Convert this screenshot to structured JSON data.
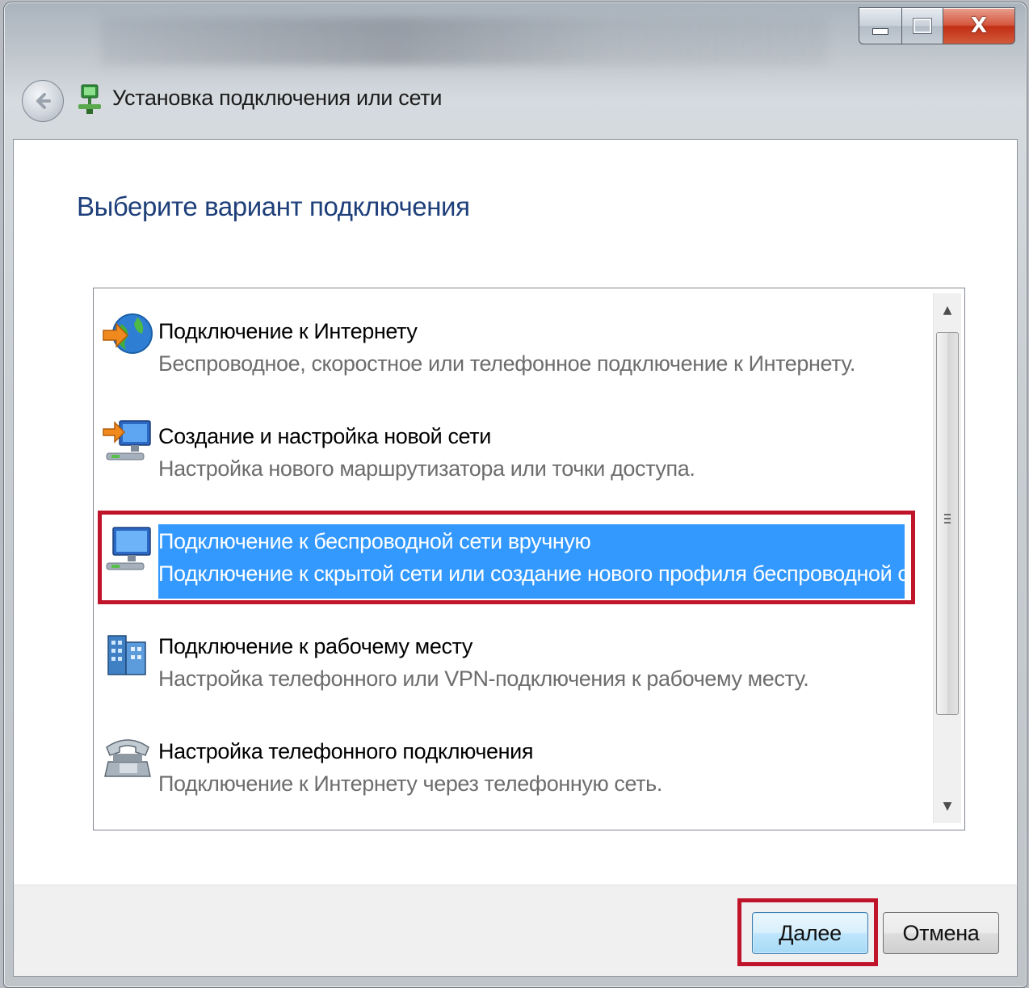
{
  "window": {
    "title": "Установка подключения или сети",
    "close_glyph": "X"
  },
  "heading": "Выберите вариант подключения",
  "options": [
    {
      "title": "Подключение к Интернету",
      "description": "Беспроводное, скоростное или телефонное подключение к Интернету.",
      "icon": "globe-icon"
    },
    {
      "title": "Создание и настройка новой сети",
      "description": "Настройка нового маршрутизатора или точки доступа.",
      "icon": "network-setup-icon"
    },
    {
      "title": "Подключение к беспроводной сети вручную",
      "description": "Подключение к скрытой сети или создание нового профиля беспроводной связи.",
      "icon": "wireless-network-icon",
      "selected": true
    },
    {
      "title": "Подключение к рабочему месту",
      "description": "Настройка телефонного или VPN-подключения к рабочему месту.",
      "icon": "workplace-building-icon"
    },
    {
      "title": "Настройка телефонного подключения",
      "description": "Подключение к Интернету через телефонную сеть.",
      "icon": "telephone-icon"
    }
  ],
  "buttons": {
    "next": "Далее",
    "cancel": "Отмена"
  },
  "colors": {
    "selection": "#3399ff",
    "highlight_box": "#c0142a",
    "heading": "#1e3f7a"
  }
}
